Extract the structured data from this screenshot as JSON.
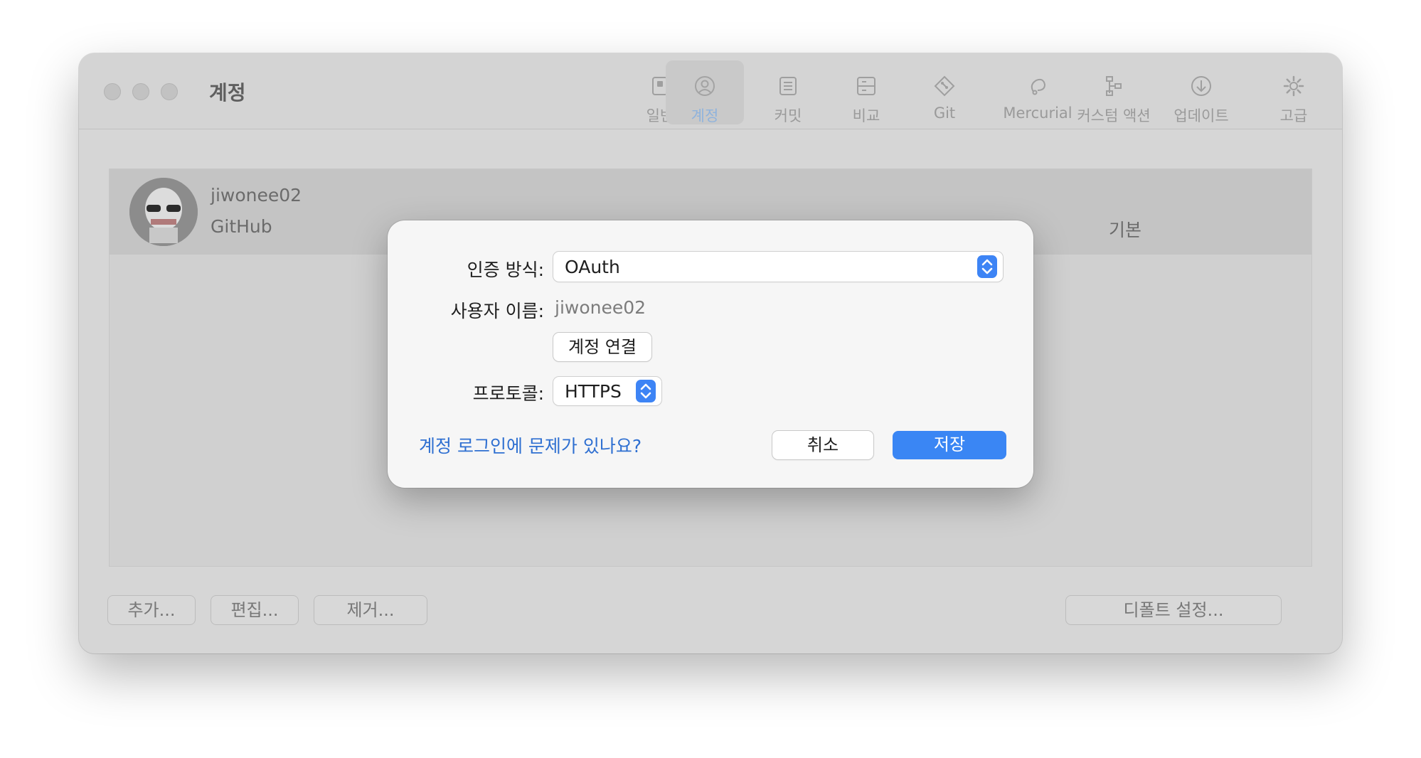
{
  "window": {
    "title": "계정",
    "toolbar": [
      {
        "label": "일반",
        "icon": "general-icon"
      },
      {
        "label": "계정",
        "icon": "account-icon",
        "active": true
      },
      {
        "label": "커밋",
        "icon": "commit-icon"
      },
      {
        "label": "비교",
        "icon": "diff-icon"
      },
      {
        "label": "Git",
        "icon": "git-icon"
      },
      {
        "label": "Mercurial",
        "icon": "mercurial-icon"
      },
      {
        "label": "커스텀 액션",
        "icon": "custom-actions-icon"
      },
      {
        "label": "업데이트",
        "icon": "update-icon"
      },
      {
        "label": "고급",
        "icon": "gear-icon"
      }
    ]
  },
  "accounts": [
    {
      "username": "jiwonee02",
      "host": "GitHub",
      "default": "기본"
    }
  ],
  "bottom_buttons": {
    "add": "추가...",
    "edit": "편집...",
    "remove": "제거...",
    "set_default": "디폴트 설정..."
  },
  "dialog": {
    "auth_label": "인증 방식:",
    "auth_value": "OAuth",
    "username_label": "사용자 이름:",
    "username_value": "jiwonee02",
    "connect_button": "계정 연결",
    "protocol_label": "프로토콜:",
    "protocol_value": "HTTPS",
    "help_link": "계정 로그인에 문제가 있나요?",
    "cancel_button": "취소",
    "save_button": "저장"
  },
  "colors": {
    "accent": "#3a86f4",
    "link": "#2e6fd1",
    "window_bg": "#d6d6d6",
    "dialog_bg": "#f6f6f6"
  }
}
